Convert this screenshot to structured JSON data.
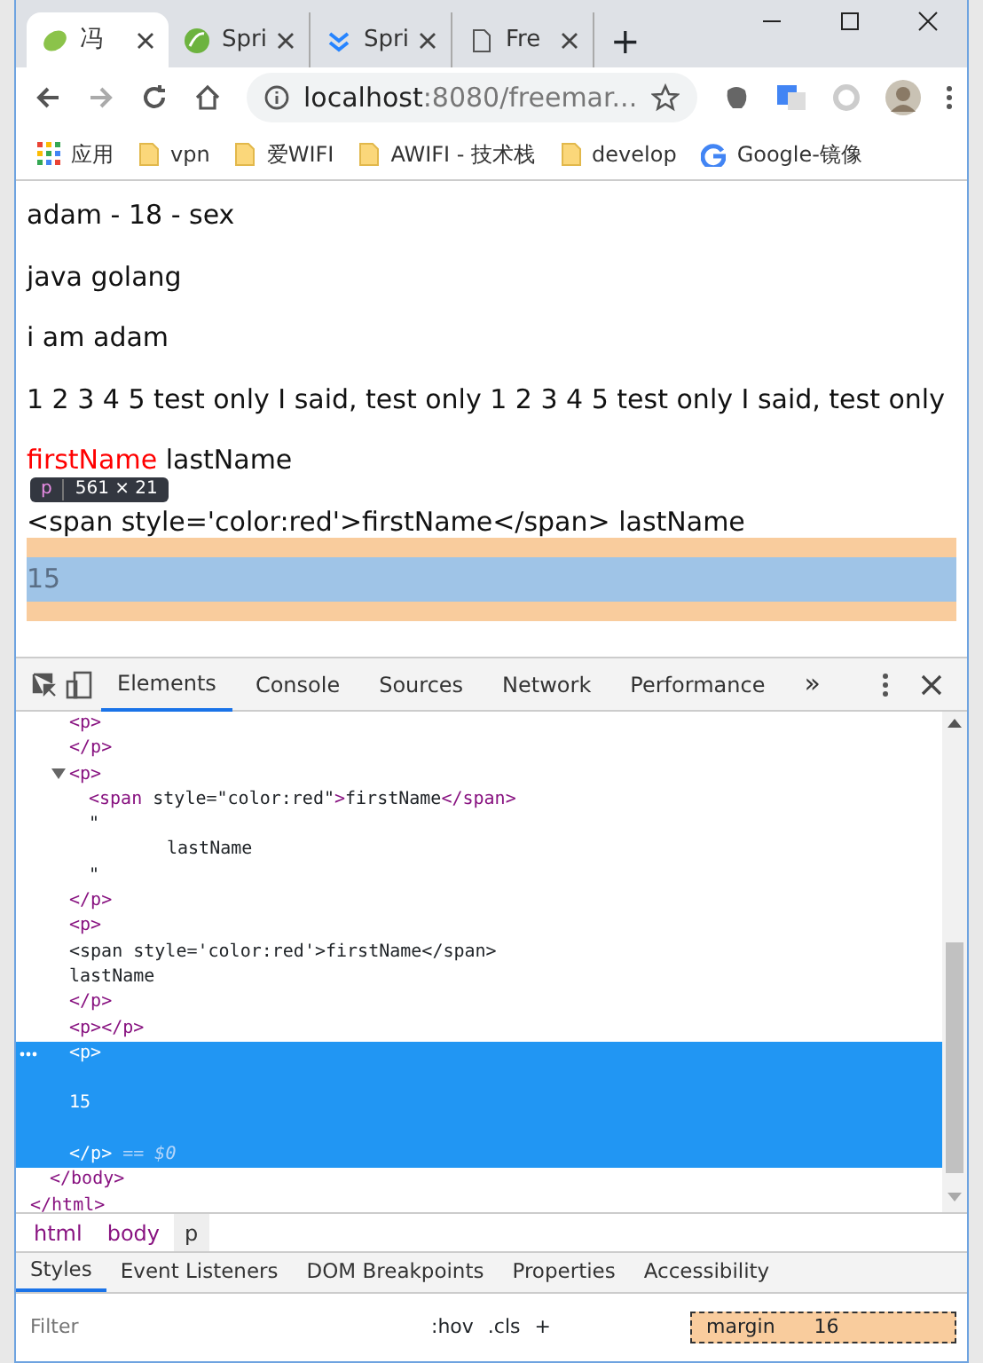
{
  "browser_tabs": [
    {
      "title": "冯",
      "selected": true
    },
    {
      "title": "Spri",
      "selected": false
    },
    {
      "title": "Spri",
      "selected": false
    },
    {
      "title": "Fre",
      "selected": false
    }
  ],
  "new_tab": "+",
  "address": {
    "host": "localhost",
    "path": ":8080/freemar..."
  },
  "bookmarks": [
    {
      "label": "应用",
      "kind": "apps"
    },
    {
      "label": "vpn",
      "kind": "folder"
    },
    {
      "label": "爱WIFI",
      "kind": "folder"
    },
    {
      "label": "AWIFI - 技术栈",
      "kind": "folder"
    },
    {
      "label": "develop",
      "kind": "folder"
    },
    {
      "label": "Google-镜像",
      "kind": "google"
    }
  ],
  "page": {
    "paragraphs": [
      {
        "spans": [
          {
            "text": "adam - 18 - sex"
          }
        ],
        "highlighted": false
      },
      {
        "spans": [
          {
            "text": "java golang"
          }
        ],
        "highlighted": false
      },
      {
        "spans": [
          {
            "text": "i am adam"
          }
        ],
        "highlighted": false
      },
      {
        "spans": [
          {
            "text": "1 2 3 4 5 test only I said, test only 1 2 3 4 5 test only I said, test only"
          }
        ],
        "highlighted": false
      },
      {
        "spans": [
          {
            "text": "firstName",
            "color": "#ff0000"
          },
          {
            "text": " lastName"
          }
        ],
        "highlighted": false
      },
      {
        "spans": [
          {
            "text": "<span style='color:red'>firstName</span> lastName"
          }
        ],
        "highlighted": false
      },
      {
        "spans": [
          {
            "text": "15"
          }
        ],
        "highlighted": true
      }
    ],
    "tooltip": {
      "tag": "p",
      "size": "561 × 21"
    }
  },
  "devtools": {
    "tabs": [
      {
        "label": "Elements",
        "selected": true
      },
      {
        "label": "Console",
        "selected": false
      },
      {
        "label": "Sources",
        "selected": false
      },
      {
        "label": "Network",
        "selected": false
      },
      {
        "label": "Performance",
        "selected": false
      }
    ],
    "more": "»",
    "dom_tree": [
      {
        "close": "</html>",
        "children": [
          {
            "close": "</body>",
            "children": [
              {
                "text": "<p>\n</p>",
                "kind": "tag",
                "selected": false
              },
              {
                "text": "<p>",
                "kind": "tag",
                "selected": false,
                "expanded": true,
                "close": "</p>",
                "children": [
                  {
                    "text": "<span style=\"color:red\">firstName</span>",
                    "kind": "tag"
                  },
                  {
                    "text": "\"",
                    "kind": "text"
                  },
                  {
                    "text": "lastName",
                    "kind": "text",
                    "indented": true
                  },
                  {
                    "text": "\"",
                    "kind": "text"
                  }
                ]
              },
              {
                "text": "<p>\n<span style='color:red'>firstName</span>\nlastName\n</p>",
                "kind": "tag",
                "selected": false
              },
              {
                "text": "<p></p>",
                "kind": "tag",
                "selected": false
              },
              {
                "text": "<p>",
                "kind": "tag",
                "selected": true,
                "content": "15",
                "close": "</p>",
                "marker": "== $0"
              }
            ]
          }
        ]
      }
    ],
    "breadcrumbs": [
      {
        "label": "html",
        "selected": false
      },
      {
        "label": "body",
        "selected": false
      },
      {
        "label": "p",
        "selected": true
      }
    ],
    "panel_tabs": [
      {
        "label": "Styles",
        "selected": true
      },
      {
        "label": "Event Listeners",
        "selected": false
      },
      {
        "label": "DOM Breakpoints",
        "selected": false
      },
      {
        "label": "Properties",
        "selected": false
      },
      {
        "label": "Accessibility",
        "selected": false
      }
    ],
    "filter": {
      "placeholder": "Filter"
    },
    "hov": ":hov",
    "cls": ".cls",
    "add": "+",
    "box_model": {
      "label": "margin",
      "value": "16"
    }
  }
}
